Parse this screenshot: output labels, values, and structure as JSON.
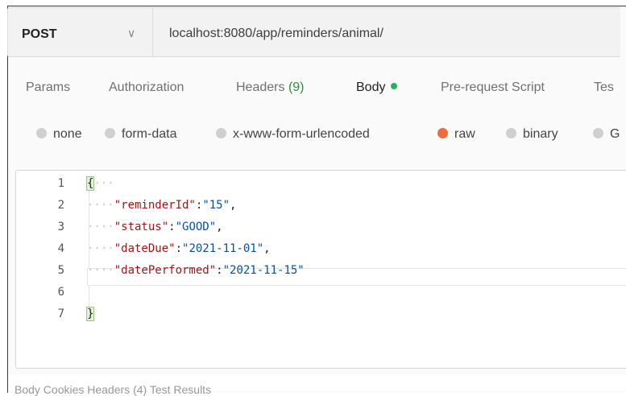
{
  "request": {
    "method": "POST",
    "url": "localhost:8080/app/reminders/animal/"
  },
  "tabs": [
    {
      "label": "Params"
    },
    {
      "label": "Authorization"
    },
    {
      "label": "Headers",
      "count": "(9)"
    },
    {
      "label": "Body",
      "active": true
    },
    {
      "label": "Pre-request Script"
    },
    {
      "label": "Tes"
    }
  ],
  "body_types": [
    {
      "label": "none"
    },
    {
      "label": "form-data"
    },
    {
      "label": "x-www-form-urlencoded"
    },
    {
      "label": "raw",
      "selected": true
    },
    {
      "label": "binary"
    },
    {
      "label": "G"
    }
  ],
  "editor": {
    "line_numbers": [
      "1",
      "2",
      "3",
      "4",
      "5",
      "6",
      "7"
    ],
    "lines": [
      {
        "open": "{",
        "dots": "···"
      },
      {
        "key": "\"reminderId\"",
        "value": "\"15\"",
        "suffix": ","
      },
      {
        "key": "\"status\"",
        "value": "\"GOOD\"",
        "suffix": ","
      },
      {
        "key": "\"dateDue\"",
        "value": "\"2021-11-01\"",
        "suffix": ","
      },
      {
        "key": "\"datePerformed\"",
        "value": "\"2021-11-15\"",
        "suffix": ""
      },
      {},
      {
        "close": "}"
      }
    ]
  },
  "colors": {
    "body_dot": "#26b15a",
    "raw_radio": "#f26b3a",
    "json_key": "#a31515",
    "json_string": "#0451a5"
  },
  "bottom_tabs_partial": "Body   Cookies   Headers (4)   Test Results"
}
